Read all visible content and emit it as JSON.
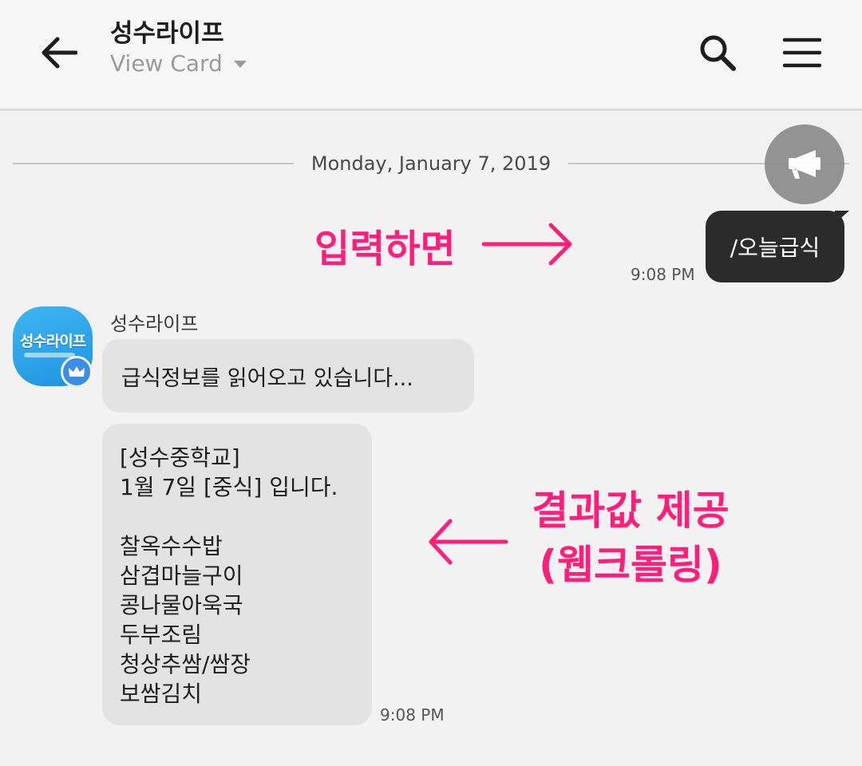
{
  "header": {
    "title": "성수라이프",
    "subtitle": "View Card"
  },
  "date_divider": "Monday, January 7, 2019",
  "annotations": {
    "input_hint": "입력하면",
    "result_line1": "결과값 제공",
    "result_line2": "(웹크롤링)",
    "color": "#ff1f7a"
  },
  "sent_message": {
    "text": "/오늘급식",
    "time": "9:08 PM"
  },
  "bot": {
    "name": "성수라이프",
    "avatar_text": "성수라이프",
    "messages": [
      {
        "text": "급식정보를 읽어오고 있습니다..."
      },
      {
        "lines": [
          "[성수중학교]",
          "1월 7일 [중식] 입니다.",
          "",
          "찰옥수수밥",
          "삼겹마늘구이",
          "콩나물아욱국",
          "두부조림",
          "청상추쌈/쌈장",
          "보쌈김치"
        ],
        "time": "9:08 PM"
      }
    ]
  },
  "icons": {
    "back": "arrow-left-icon",
    "search": "search-icon",
    "menu": "hamburger-menu-icon",
    "announce": "megaphone-icon",
    "badge": "crown-icon"
  }
}
